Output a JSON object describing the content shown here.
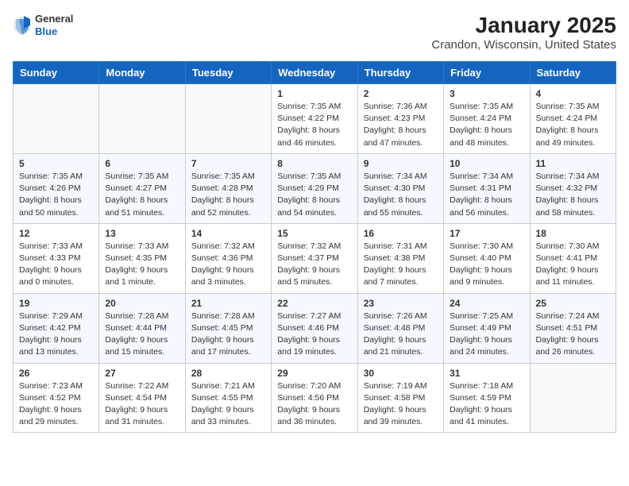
{
  "header": {
    "logo": {
      "general": "General",
      "blue": "Blue"
    },
    "title": "January 2025",
    "subtitle": "Crandon, Wisconsin, United States"
  },
  "days_of_week": [
    "Sunday",
    "Monday",
    "Tuesday",
    "Wednesday",
    "Thursday",
    "Friday",
    "Saturday"
  ],
  "weeks": [
    [
      {
        "day": "",
        "sunrise": "",
        "sunset": "",
        "daylight": ""
      },
      {
        "day": "",
        "sunrise": "",
        "sunset": "",
        "daylight": ""
      },
      {
        "day": "",
        "sunrise": "",
        "sunset": "",
        "daylight": ""
      },
      {
        "day": "1",
        "sunrise": "Sunrise: 7:35 AM",
        "sunset": "Sunset: 4:22 PM",
        "daylight": "Daylight: 8 hours and 46 minutes."
      },
      {
        "day": "2",
        "sunrise": "Sunrise: 7:36 AM",
        "sunset": "Sunset: 4:23 PM",
        "daylight": "Daylight: 8 hours and 47 minutes."
      },
      {
        "day": "3",
        "sunrise": "Sunrise: 7:35 AM",
        "sunset": "Sunset: 4:24 PM",
        "daylight": "Daylight: 8 hours and 48 minutes."
      },
      {
        "day": "4",
        "sunrise": "Sunrise: 7:35 AM",
        "sunset": "Sunset: 4:24 PM",
        "daylight": "Daylight: 8 hours and 49 minutes."
      }
    ],
    [
      {
        "day": "5",
        "sunrise": "Sunrise: 7:35 AM",
        "sunset": "Sunset: 4:26 PM",
        "daylight": "Daylight: 8 hours and 50 minutes."
      },
      {
        "day": "6",
        "sunrise": "Sunrise: 7:35 AM",
        "sunset": "Sunset: 4:27 PM",
        "daylight": "Daylight: 8 hours and 51 minutes."
      },
      {
        "day": "7",
        "sunrise": "Sunrise: 7:35 AM",
        "sunset": "Sunset: 4:28 PM",
        "daylight": "Daylight: 8 hours and 52 minutes."
      },
      {
        "day": "8",
        "sunrise": "Sunrise: 7:35 AM",
        "sunset": "Sunset: 4:29 PM",
        "daylight": "Daylight: 8 hours and 54 minutes."
      },
      {
        "day": "9",
        "sunrise": "Sunrise: 7:34 AM",
        "sunset": "Sunset: 4:30 PM",
        "daylight": "Daylight: 8 hours and 55 minutes."
      },
      {
        "day": "10",
        "sunrise": "Sunrise: 7:34 AM",
        "sunset": "Sunset: 4:31 PM",
        "daylight": "Daylight: 8 hours and 56 minutes."
      },
      {
        "day": "11",
        "sunrise": "Sunrise: 7:34 AM",
        "sunset": "Sunset: 4:32 PM",
        "daylight": "Daylight: 8 hours and 58 minutes."
      }
    ],
    [
      {
        "day": "12",
        "sunrise": "Sunrise: 7:33 AM",
        "sunset": "Sunset: 4:33 PM",
        "daylight": "Daylight: 9 hours and 0 minutes."
      },
      {
        "day": "13",
        "sunrise": "Sunrise: 7:33 AM",
        "sunset": "Sunset: 4:35 PM",
        "daylight": "Daylight: 9 hours and 1 minute."
      },
      {
        "day": "14",
        "sunrise": "Sunrise: 7:32 AM",
        "sunset": "Sunset: 4:36 PM",
        "daylight": "Daylight: 9 hours and 3 minutes."
      },
      {
        "day": "15",
        "sunrise": "Sunrise: 7:32 AM",
        "sunset": "Sunset: 4:37 PM",
        "daylight": "Daylight: 9 hours and 5 minutes."
      },
      {
        "day": "16",
        "sunrise": "Sunrise: 7:31 AM",
        "sunset": "Sunset: 4:38 PM",
        "daylight": "Daylight: 9 hours and 7 minutes."
      },
      {
        "day": "17",
        "sunrise": "Sunrise: 7:30 AM",
        "sunset": "Sunset: 4:40 PM",
        "daylight": "Daylight: 9 hours and 9 minutes."
      },
      {
        "day": "18",
        "sunrise": "Sunrise: 7:30 AM",
        "sunset": "Sunset: 4:41 PM",
        "daylight": "Daylight: 9 hours and 11 minutes."
      }
    ],
    [
      {
        "day": "19",
        "sunrise": "Sunrise: 7:29 AM",
        "sunset": "Sunset: 4:42 PM",
        "daylight": "Daylight: 9 hours and 13 minutes."
      },
      {
        "day": "20",
        "sunrise": "Sunrise: 7:28 AM",
        "sunset": "Sunset: 4:44 PM",
        "daylight": "Daylight: 9 hours and 15 minutes."
      },
      {
        "day": "21",
        "sunrise": "Sunrise: 7:28 AM",
        "sunset": "Sunset: 4:45 PM",
        "daylight": "Daylight: 9 hours and 17 minutes."
      },
      {
        "day": "22",
        "sunrise": "Sunrise: 7:27 AM",
        "sunset": "Sunset: 4:46 PM",
        "daylight": "Daylight: 9 hours and 19 minutes."
      },
      {
        "day": "23",
        "sunrise": "Sunrise: 7:26 AM",
        "sunset": "Sunset: 4:48 PM",
        "daylight": "Daylight: 9 hours and 21 minutes."
      },
      {
        "day": "24",
        "sunrise": "Sunrise: 7:25 AM",
        "sunset": "Sunset: 4:49 PM",
        "daylight": "Daylight: 9 hours and 24 minutes."
      },
      {
        "day": "25",
        "sunrise": "Sunrise: 7:24 AM",
        "sunset": "Sunset: 4:51 PM",
        "daylight": "Daylight: 9 hours and 26 minutes."
      }
    ],
    [
      {
        "day": "26",
        "sunrise": "Sunrise: 7:23 AM",
        "sunset": "Sunset: 4:52 PM",
        "daylight": "Daylight: 9 hours and 29 minutes."
      },
      {
        "day": "27",
        "sunrise": "Sunrise: 7:22 AM",
        "sunset": "Sunset: 4:54 PM",
        "daylight": "Daylight: 9 hours and 31 minutes."
      },
      {
        "day": "28",
        "sunrise": "Sunrise: 7:21 AM",
        "sunset": "Sunset: 4:55 PM",
        "daylight": "Daylight: 9 hours and 33 minutes."
      },
      {
        "day": "29",
        "sunrise": "Sunrise: 7:20 AM",
        "sunset": "Sunset: 4:56 PM",
        "daylight": "Daylight: 9 hours and 36 minutes."
      },
      {
        "day": "30",
        "sunrise": "Sunrise: 7:19 AM",
        "sunset": "Sunset: 4:58 PM",
        "daylight": "Daylight: 9 hours and 39 minutes."
      },
      {
        "day": "31",
        "sunrise": "Sunrise: 7:18 AM",
        "sunset": "Sunset: 4:59 PM",
        "daylight": "Daylight: 9 hours and 41 minutes."
      },
      {
        "day": "",
        "sunrise": "",
        "sunset": "",
        "daylight": ""
      }
    ]
  ]
}
